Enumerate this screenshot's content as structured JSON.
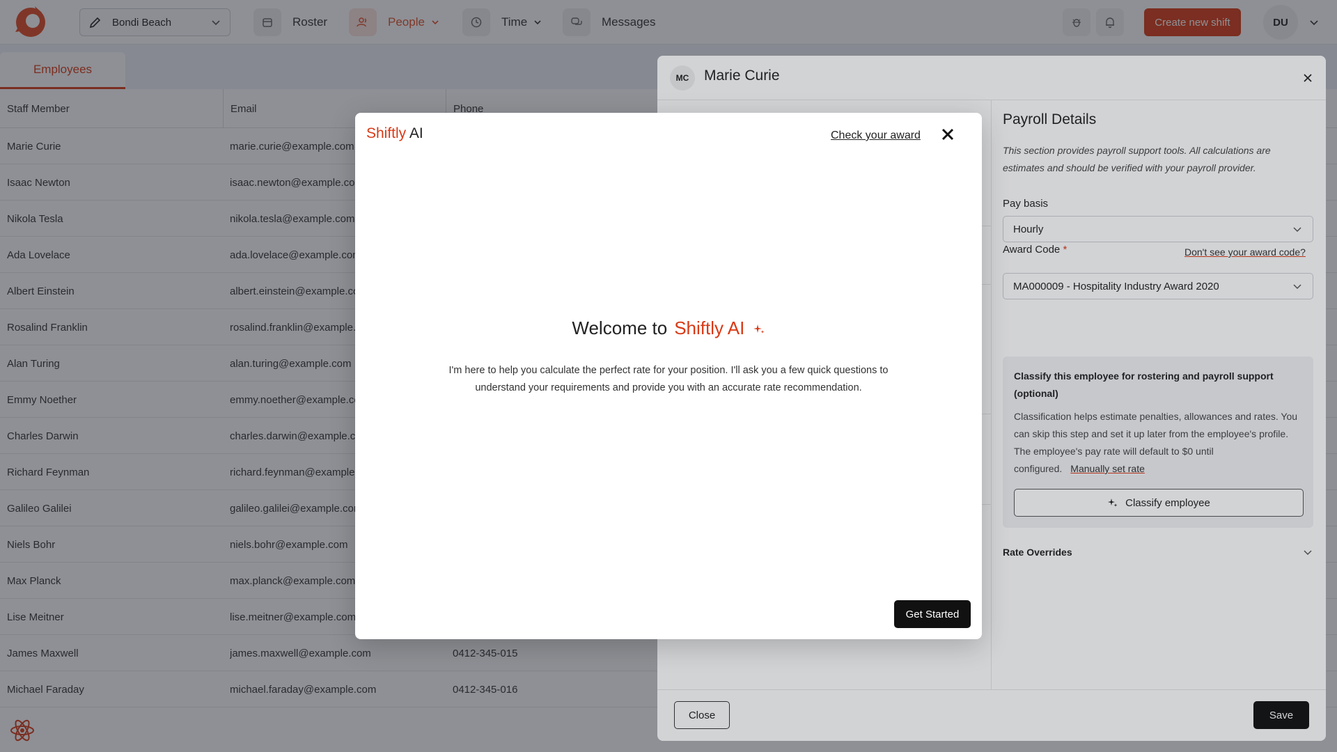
{
  "colors": {
    "brand": "#d93a16",
    "dark_button": "#111111"
  },
  "nav": {
    "location": "Bondi Beach",
    "roster": "Roster",
    "people": "People",
    "time": "Time",
    "messages": "Messages",
    "create_shift": "Create new shift",
    "user_initials": "DU"
  },
  "employees": {
    "tab": "Employees",
    "headers": [
      "Staff Member",
      "Email",
      "Phone"
    ],
    "rows": [
      {
        "name": "Marie Curie",
        "email": "marie.curie@example.com",
        "phone": ""
      },
      {
        "name": "Isaac Newton",
        "email": "isaac.newton@example.com",
        "phone": ""
      },
      {
        "name": "Nikola Tesla",
        "email": "nikola.tesla@example.com",
        "phone": ""
      },
      {
        "name": "Ada Lovelace",
        "email": "ada.lovelace@example.com",
        "phone": ""
      },
      {
        "name": "Albert Einstein",
        "email": "albert.einstein@example.com",
        "phone": ""
      },
      {
        "name": "Rosalind Franklin",
        "email": "rosalind.franklin@example.com",
        "phone": ""
      },
      {
        "name": "Alan Turing",
        "email": "alan.turing@example.com",
        "phone": ""
      },
      {
        "name": "Emmy Noether",
        "email": "emmy.noether@example.com",
        "phone": ""
      },
      {
        "name": "Charles Darwin",
        "email": "charles.darwin@example.com",
        "phone": ""
      },
      {
        "name": "Richard Feynman",
        "email": "richard.feynman@example.com",
        "phone": ""
      },
      {
        "name": "Galileo Galilei",
        "email": "galileo.galilei@example.com",
        "phone": ""
      },
      {
        "name": "Niels Bohr",
        "email": "niels.bohr@example.com",
        "phone": ""
      },
      {
        "name": "Max Planck",
        "email": "max.planck@example.com",
        "phone": ""
      },
      {
        "name": "Lise Meitner",
        "email": "lise.meitner@example.com",
        "phone": ""
      },
      {
        "name": "James Maxwell",
        "email": "james.maxwell@example.com",
        "phone": "0412-345-015"
      },
      {
        "name": "Michael Faraday",
        "email": "michael.faraday@example.com",
        "phone": "0412-345-016"
      }
    ]
  },
  "panel": {
    "initials": "MC",
    "name": "Marie Curie",
    "payroll": {
      "title": "Payroll Details",
      "description": "This section provides payroll support tools. All calculations are estimates and should be verified with your payroll provider.",
      "pay_basis_label": "Pay basis",
      "pay_basis_value": "Hourly",
      "award_code_label": "Award Code",
      "required_mark": "*",
      "award_link": "Don't see your award code?",
      "award_code_value": "MA000009 - Hospitality Industry Award 2020",
      "classify_title": "Classify this employee for rostering and payroll support (optional)",
      "classify_desc": "Classification helps estimate penalties, allowances and rates. You can skip this step and set it up later from the employee's profile. The employee's pay rate will default to $0 until configured.",
      "manual_rate_link": "Manually set rate",
      "classify_button": "Classify employee",
      "rate_overrides": "Rate Overrides"
    },
    "close_button": "Close",
    "save_button": "Save"
  },
  "modal": {
    "brand_prefix": "Shiftly",
    "brand_suffix": "AI",
    "check_award": "Check your award",
    "welcome_prefix": "Welcome to",
    "welcome_brand": "Shiftly AI",
    "intro": "I'm here to help you calculate the perfect rate for your position. I'll ask you a few quick questions to understand your requirements and provide you with an accurate rate recommendation.",
    "get_started": "Get Started"
  }
}
